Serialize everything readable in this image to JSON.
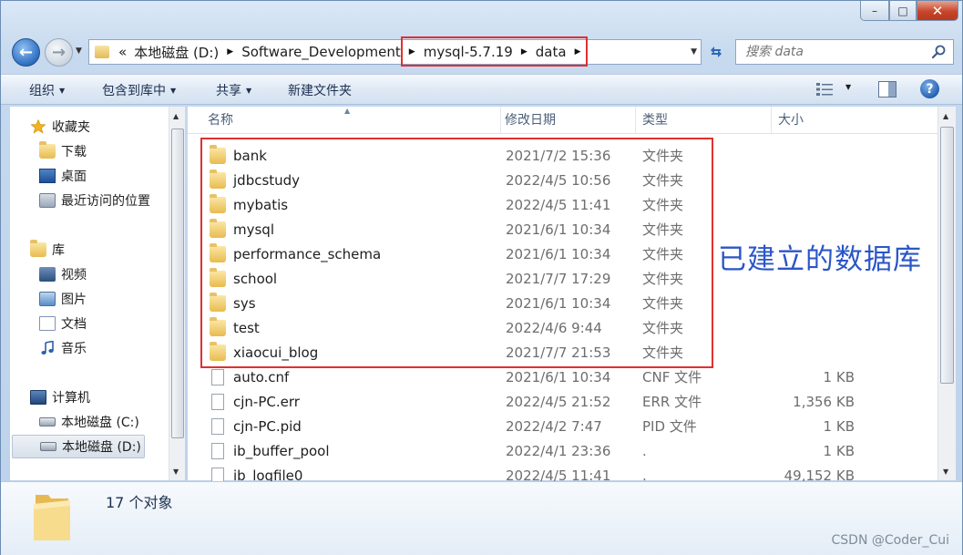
{
  "window": {
    "caption": {
      "minimize": "–",
      "maximize": "□",
      "close": "✕"
    }
  },
  "nav": {
    "back_glyph": "←",
    "forward_glyph": "→",
    "address": {
      "overflow": "«",
      "segments": [
        "本地磁盘 (D:)",
        "Software_Development",
        "mysql-5.7.19",
        "data"
      ]
    },
    "search_placeholder": "搜索 data"
  },
  "toolbar": {
    "organize": "组织",
    "include_in_library": "包含到库中",
    "share": "共享",
    "new_folder": "新建文件夹",
    "help_glyph": "?"
  },
  "sidebar": {
    "favorites": {
      "label": "收藏夹",
      "items": [
        "下载",
        "桌面",
        "最近访问的位置"
      ]
    },
    "libraries": {
      "label": "库",
      "items": [
        "视频",
        "图片",
        "文档",
        "音乐"
      ]
    },
    "computer": {
      "label": "计算机",
      "items": [
        "本地磁盘 (C:)",
        "本地磁盘 (D:)"
      ]
    }
  },
  "columns": {
    "name": "名称",
    "modified": "修改日期",
    "type": "类型",
    "size": "大小"
  },
  "files": [
    {
      "name": "bank",
      "modified": "2021/7/2 15:36",
      "type": "文件夹",
      "size": "",
      "kind": "folder"
    },
    {
      "name": "jdbcstudy",
      "modified": "2022/4/5 10:56",
      "type": "文件夹",
      "size": "",
      "kind": "folder"
    },
    {
      "name": "mybatis",
      "modified": "2022/4/5 11:41",
      "type": "文件夹",
      "size": "",
      "kind": "folder"
    },
    {
      "name": "mysql",
      "modified": "2021/6/1 10:34",
      "type": "文件夹",
      "size": "",
      "kind": "folder"
    },
    {
      "name": "performance_schema",
      "modified": "2021/6/1 10:34",
      "type": "文件夹",
      "size": "",
      "kind": "folder"
    },
    {
      "name": "school",
      "modified": "2021/7/7 17:29",
      "type": "文件夹",
      "size": "",
      "kind": "folder"
    },
    {
      "name": "sys",
      "modified": "2021/6/1 10:34",
      "type": "文件夹",
      "size": "",
      "kind": "folder"
    },
    {
      "name": "test",
      "modified": "2022/4/6 9:44",
      "type": "文件夹",
      "size": "",
      "kind": "folder"
    },
    {
      "name": "xiaocui_blog",
      "modified": "2021/7/7 21:53",
      "type": "文件夹",
      "size": "",
      "kind": "folder"
    },
    {
      "name": "auto.cnf",
      "modified": "2021/6/1 10:34",
      "type": "CNF 文件",
      "size": "1 KB",
      "kind": "file"
    },
    {
      "name": "cjn-PC.err",
      "modified": "2022/4/5 21:52",
      "type": "ERR 文件",
      "size": "1,356 KB",
      "kind": "file"
    },
    {
      "name": "cjn-PC.pid",
      "modified": "2022/4/2 7:47",
      "type": "PID 文件",
      "size": "1 KB",
      "kind": "file"
    },
    {
      "name": "ib_buffer_pool",
      "modified": "2022/4/1 23:36",
      "type": ".",
      "size": "1 KB",
      "kind": "file"
    },
    {
      "name": "ib_logfile0",
      "modified": "2022/4/5 11:41",
      "type": ".",
      "size": "49,152 KB",
      "kind": "file"
    }
  ],
  "annotation": "已建立的数据库",
  "status": {
    "count_text": "17 个对象"
  },
  "watermark": "CSDN @Coder_Cui",
  "colors": {
    "highlight": "#e03030",
    "annotation": "#2b56c8",
    "folder": "#e8bb4f"
  }
}
